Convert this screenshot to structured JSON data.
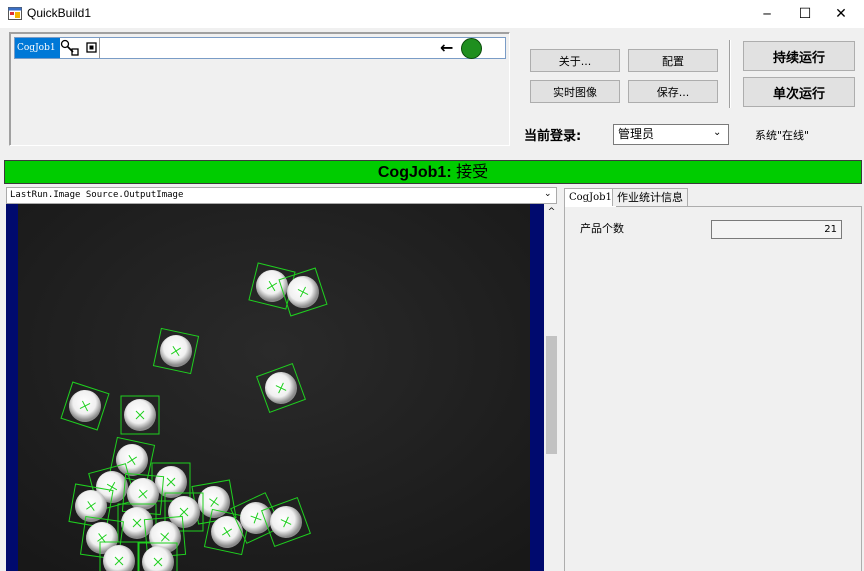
{
  "window": {
    "title": "QuickBuild1",
    "controls": {
      "minimize": "─",
      "maximize": "☐",
      "close": "✕"
    }
  },
  "job_strip": {
    "job_name": "CogJob1",
    "arrow": "←",
    "status_color": "#1f8f1f"
  },
  "buttons": {
    "about": "关于...",
    "config": "配置",
    "live_image": "实时图像",
    "save": "保存...",
    "run_continuous": "持续运行",
    "run_once": "单次运行"
  },
  "login": {
    "label": "当前登录:",
    "value": "管理员",
    "system_status": "系统\"在线\""
  },
  "status_bar": {
    "job": "CogJob1",
    "sep": ": ",
    "state": "接受",
    "color": "#00cc00"
  },
  "image_view": {
    "source": "LastRun.Image Source.OutputImage",
    "scroll_up": "^"
  },
  "tabs": [
    {
      "label": "CogJob1"
    },
    {
      "label": "作业统计信息"
    }
  ],
  "stats": {
    "count_label": "产品个数",
    "count_value": "21"
  }
}
